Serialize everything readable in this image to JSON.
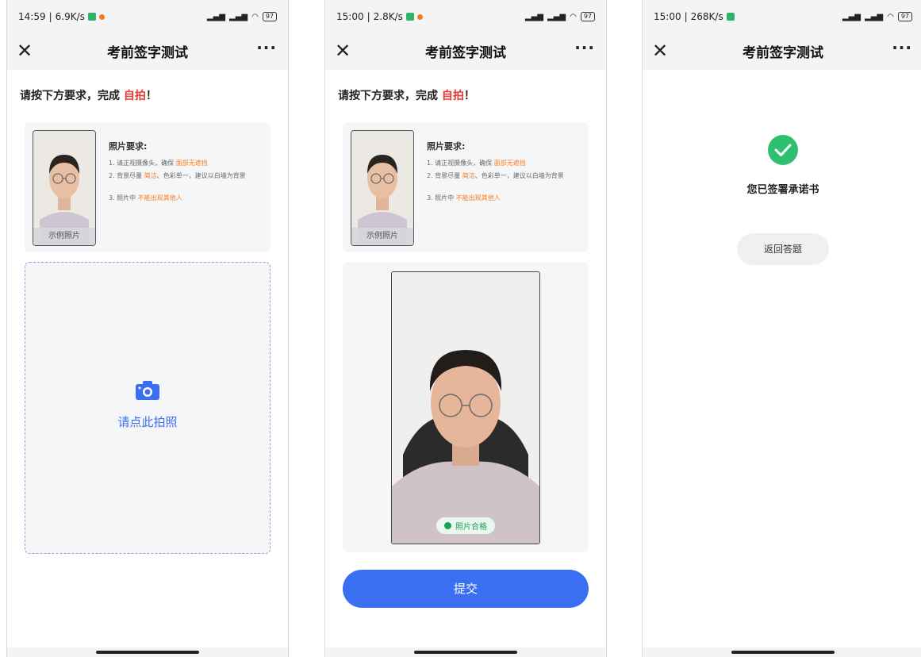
{
  "screens": [
    {
      "status": {
        "time": "14:59",
        "speed": "6.9K/s",
        "battery": "97"
      },
      "nav": {
        "title": "考前签字测试",
        "more": "···",
        "close": "✕"
      },
      "instruction": {
        "prefix": "请按下方要求，完成 ",
        "highlight": "自拍",
        "suffix": "！"
      },
      "requirements": {
        "caption": "示例照片",
        "title": "照片要求:",
        "line1_pre": "1. 请正视摄像头，确保 ",
        "line1_hl": "面部无遮挡",
        "line2_pre": "2. 背景尽量 ",
        "line2_hl": "简洁",
        "line2_post": "、色彩单一，建议以白墙为背景",
        "line3_pre": "3. 照片中 ",
        "line3_hl": "不能出现其他人"
      },
      "upload_label": "请点此拍照"
    },
    {
      "status": {
        "time": "15:00",
        "speed": "2.8K/s",
        "battery": "97"
      },
      "nav": {
        "title": "考前签字测试",
        "more": "···",
        "close": "✕"
      },
      "instruction": {
        "prefix": "请按下方要求，完成 ",
        "highlight": "自拍",
        "suffix": "！"
      },
      "requirements": {
        "caption": "示例照片",
        "title": "照片要求:",
        "line1_pre": "1. 请正视摄像头，确保 ",
        "line1_hl": "面部无遮挡",
        "line2_pre": "2. 背景尽量 ",
        "line2_hl": "简洁",
        "line2_post": "、色彩单一，建议以白墙为背景",
        "line3_pre": "3. 照片中 ",
        "line3_hl": "不能出现其他人"
      },
      "pass_badge": "照片合格",
      "submit_label": "提交"
    },
    {
      "status": {
        "time": "15:00",
        "speed": "268K/s",
        "battery": "97"
      },
      "nav": {
        "title": "考前签字测试",
        "more": "···",
        "close": "✕"
      },
      "done_text": "您已签署承诺书",
      "back_label": "返回答题"
    }
  ],
  "colors": {
    "accent": "#3b6ff2",
    "highlight": "#ff7a1a",
    "red": "#e53935",
    "success": "#1f9d57"
  },
  "icons": [
    "close-icon",
    "more-icon",
    "camera-icon",
    "check-circle-icon"
  ]
}
